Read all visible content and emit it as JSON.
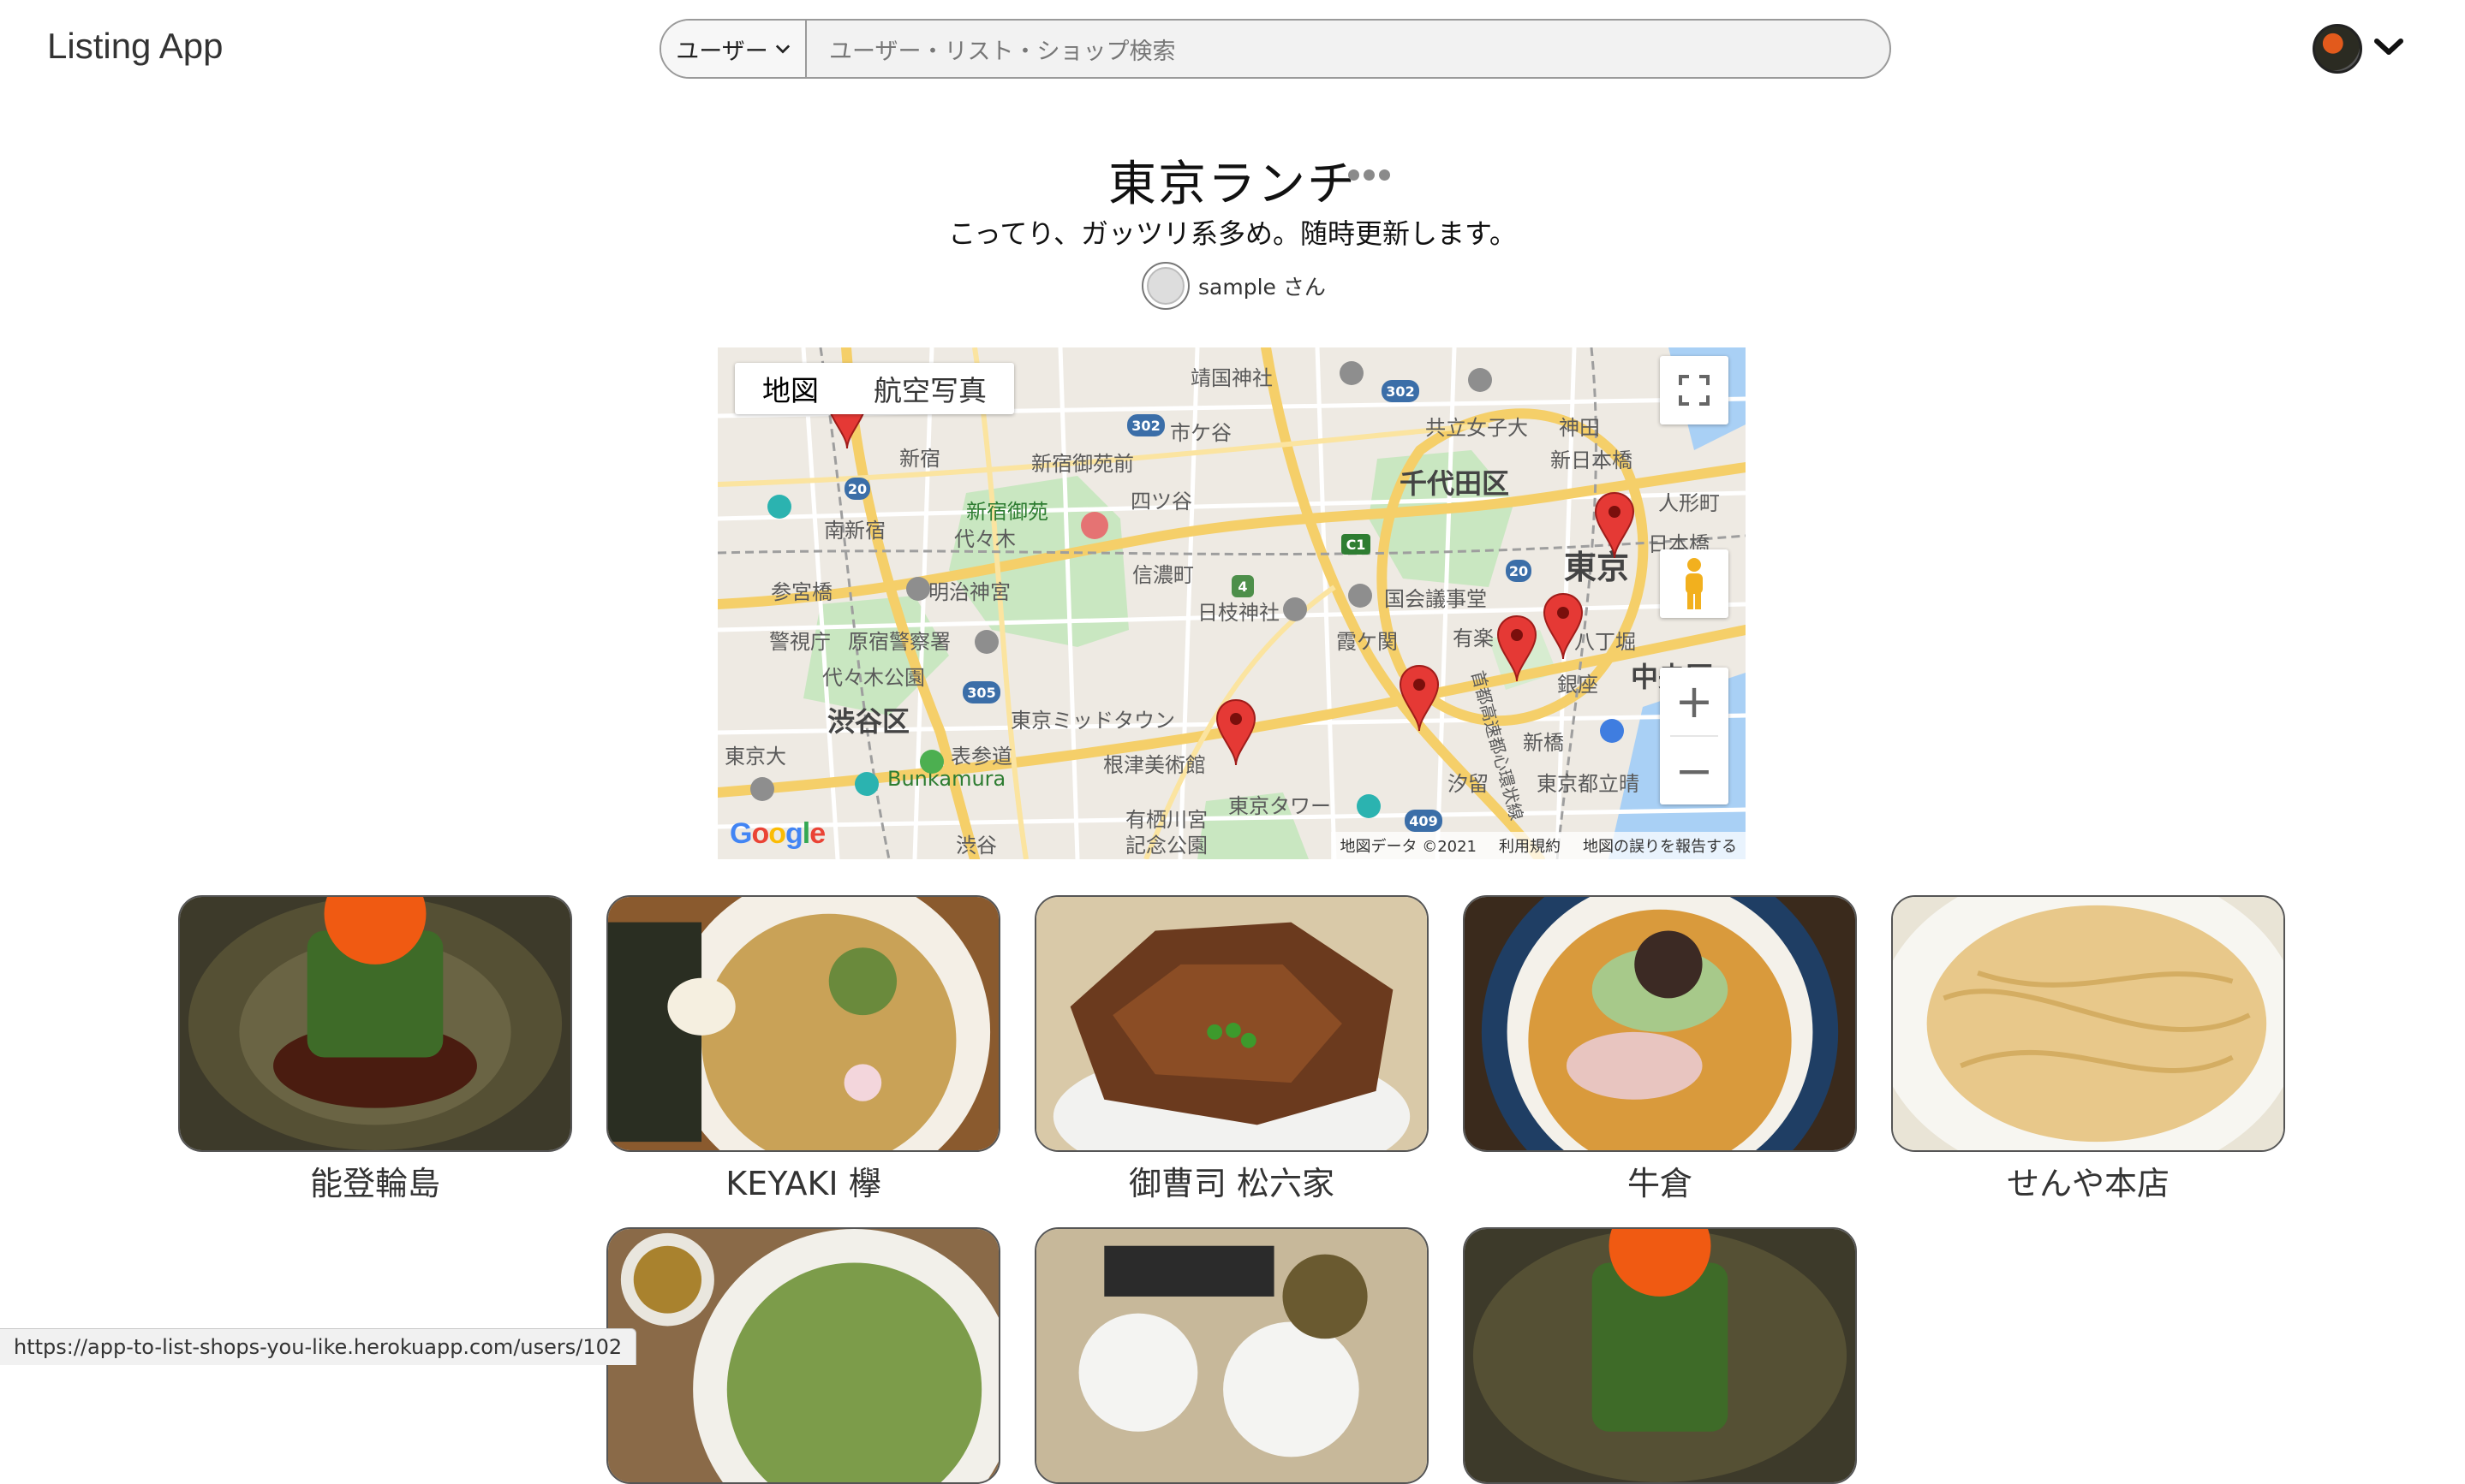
{
  "header": {
    "brand": "Listing App",
    "search_scope": "ユーザー",
    "search_placeholder": "ユーザー・リスト・ショップ検索"
  },
  "list": {
    "title": "東京ランチ",
    "description": "こってり、ガッツリ系多め。随時更新します。",
    "owner": "sample さん"
  },
  "map": {
    "type_tabs": [
      "地図",
      "航空写真"
    ],
    "active_tab": "地図",
    "attribution": [
      "地図データ ©2021",
      "利用規約",
      "地図の誤りを報告する"
    ],
    "logo": "Google",
    "labels": [
      "靖国神社",
      "市ケ谷",
      "共立女子大",
      "神田",
      "新日本橋",
      "人形町",
      "千代田区",
      "新宿",
      "新宿御苑前",
      "四ツ谷",
      "新宿御苑",
      "代々木",
      "南新宿",
      "信濃町",
      "日本橋",
      "東京",
      "明治神宮",
      "日枝神社",
      "国会議事堂",
      "八丁堀",
      "参宮橋",
      "有楽町",
      "霞ケ関",
      "原宿警察署",
      "警視庁",
      "代々木公園",
      "銀座",
      "渋谷区",
      "東京ミッドタウン",
      "新橋",
      "表参道",
      "根津美術館",
      "汐留",
      "東京都立晴",
      "Bunkamura",
      "有栖川宮記念公園",
      "東京タワー",
      "渋谷",
      "東京大",
      "中央区",
      "首都高速都心環状線"
    ],
    "route_numbers": [
      "302",
      "302",
      "20",
      "20",
      "4",
      "305",
      "409",
      "C1"
    ]
  },
  "shops": [
    {
      "name": "能登輪島"
    },
    {
      "name": "KEYAKI 欅"
    },
    {
      "name": "御曹司 松六家"
    },
    {
      "name": "牛倉"
    },
    {
      "name": "せんや本店"
    }
  ],
  "status_url": "https://app-to-list-shops-you-like.herokuapp.com/users/102",
  "colors": {
    "pin": "#e53935",
    "park": "#c8e6c0",
    "road": "#f7d77a",
    "water": "#9cc8f2"
  }
}
